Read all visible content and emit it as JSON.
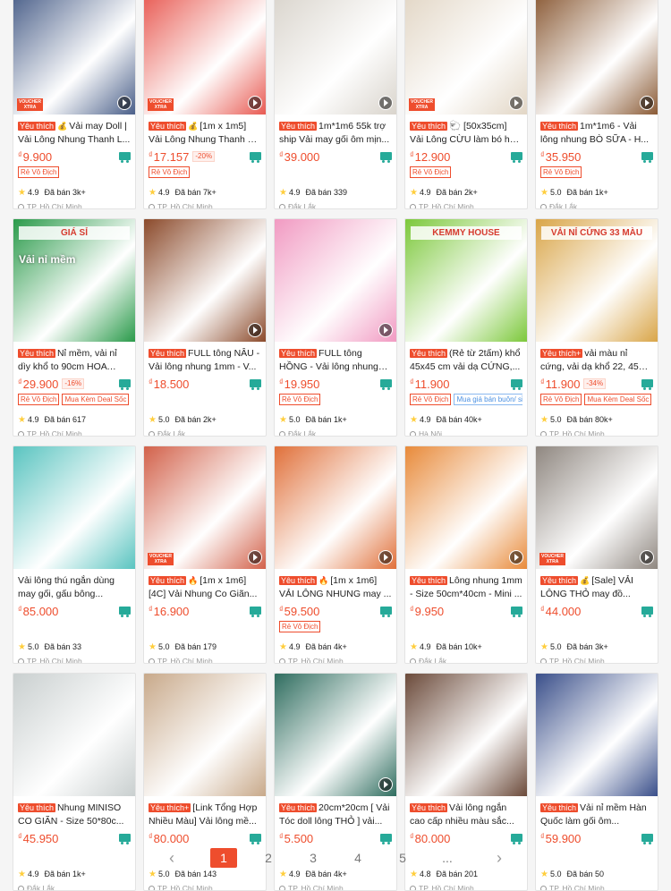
{
  "products": [
    {
      "title": "Vải may Doll | Vải Lông Nhung Thanh L...",
      "tag": "Yêu thích",
      "fire": "💰",
      "price": "9.900",
      "currency": "₫",
      "discount": "",
      "badges": [
        "Rẻ Vô Địch"
      ],
      "rating": "4.9",
      "sold": "Đã bán 3k+",
      "location": "TP. Hồ Chí Minh",
      "thumb": "#4a5f89",
      "video": true,
      "voucher": true
    },
    {
      "title": "[1m x 1m5] Vải Lông Nhung Thanh Lý m...",
      "tag": "Yêu thích",
      "fire": "💰",
      "price": "17.157",
      "currency": "₫",
      "discount": "-20%",
      "badges": [
        "Rẻ Vô Địch"
      ],
      "rating": "4.9",
      "sold": "Đã bán 7k+",
      "location": "TP. Hồ Chí Minh",
      "thumb": "#e85a52",
      "video": true,
      "voucher": true
    },
    {
      "title": "1m*1m6 55k trợ ship Vải may gối ôm mịn...",
      "tag": "Yêu thích",
      "fire": "",
      "price": "39.000",
      "currency": "₫",
      "discount": "",
      "badges": [],
      "rating": "4.9",
      "sold": "Đã bán 339",
      "location": "Đắk Lắk",
      "thumb": "#d9d4cc",
      "video": true,
      "voucher": false
    },
    {
      "title": "🐑 [50x35cm] Vải Lông CỪU làm bó hoa ta...",
      "tag": "Yêu thích",
      "fire": "",
      "price": "12.900",
      "currency": "₫",
      "discount": "",
      "badges": [
        "Rẻ Vô Địch"
      ],
      "rating": "4.9",
      "sold": "Đã bán 2k+",
      "location": "TP. Hồ Chí Minh",
      "thumb": "#e2d6c5",
      "video": true,
      "voucher": true
    },
    {
      "title": "1m*1m6 - Vải lông nhung BÒ SỮA - H...",
      "tag": "Yêu thích",
      "fire": "",
      "price": "35.950",
      "currency": "₫",
      "discount": "",
      "badges": [
        "Rẻ Vô Địch"
      ],
      "rating": "5.0",
      "sold": "Đã bán 1k+",
      "location": "Đắk Lắk",
      "thumb": "#8a5a35",
      "video": true,
      "voucher": false
    },
    {
      "title": "Nỉ mềm, vải nỉ dìy khổ to 90cm HOA GẠ...",
      "tag": "Yêu thích",
      "fire": "",
      "price": "29.900",
      "currency": "₫",
      "discount": "-16%",
      "badges": [
        "Rẻ Vô Địch",
        "Mua Kèm Deal Sốc"
      ],
      "rating": "4.9",
      "sold": "Đã bán 617",
      "location": "TP. Hồ Chí Minh",
      "thumb": "#2a9a4a",
      "video": false,
      "voucher": false,
      "banner": "GIÁ SỈ",
      "overlay": "Vải nỉ mềm"
    },
    {
      "title": "FULL tông NÂU - Vải lông nhung 1mm - V...",
      "tag": "Yêu thích",
      "fire": "",
      "price": "18.500",
      "currency": "₫",
      "discount": "",
      "badges": [],
      "rating": "5.0",
      "sold": "Đã bán 2k+",
      "location": "Đắk Lắk",
      "thumb": "#8b4a2b",
      "video": true,
      "voucher": false
    },
    {
      "title": "FULL tông HỒNG - Vải lông nhung 1mm - ...",
      "tag": "Yêu thích",
      "fire": "",
      "price": "19.950",
      "currency": "₫",
      "discount": "",
      "badges": [
        "Rẻ Vô Địch"
      ],
      "rating": "5.0",
      "sold": "Đã bán 1k+",
      "location": "Đắk Lắk",
      "thumb": "#f19ac2",
      "video": true,
      "voucher": false
    },
    {
      "title": "(Rẻ từ 2tấm) khổ 45x45 cm vải dạ CỨNG,...",
      "tag": "Yêu thích",
      "fire": "",
      "price": "11.900",
      "currency": "₫",
      "discount": "",
      "badges": [
        "Rẻ Vô Địch",
        "Mua giá bán buôn/ sỉ"
      ],
      "rating": "4.9",
      "sold": "Đã bán 40k+",
      "location": "Hà Nội",
      "thumb": "#7cc83b",
      "video": false,
      "voucher": false,
      "banner": "KEMMY HOUSE"
    },
    {
      "title": "vải màu nỉ cứng, vải dạ khổ 22, 45 cm...",
      "tag": "Yêu thích+",
      "fire": "",
      "price": "11.900",
      "currency": "₫",
      "discount": "-34%",
      "badges": [
        "Rẻ Vô Địch",
        "Mua Kèm Deal Sốc"
      ],
      "rating": "5.0",
      "sold": "Đã bán 80k+",
      "location": "TP. Hồ Chí Minh",
      "thumb": "#d9a548",
      "video": false,
      "voucher": false,
      "banner": "VẢI NỈ CỨNG 33 MÀU"
    },
    {
      "title": "Vải lông thú ngắn dùng may gối, gấu bông...",
      "tag": "",
      "fire": "",
      "price": "85.000",
      "currency": "₫",
      "discount": "",
      "badges": [],
      "rating": "5.0",
      "sold": "Đã bán 33",
      "location": "TP. Hồ Chí Minh",
      "thumb": "#5ac4c0",
      "video": false,
      "voucher": false
    },
    {
      "title": "[1m x 1m6] [4C] Vải Nhung Co Giãn...",
      "tag": "Yêu thích",
      "fire": "🔥",
      "price": "16.900",
      "currency": "₫",
      "discount": "",
      "badges": [],
      "rating": "5.0",
      "sold": "Đã bán 179",
      "location": "TP. Hồ Chí Minh",
      "thumb": "#d2614a",
      "video": true,
      "voucher": true
    },
    {
      "title": "[1m x 1m6] VẢI LÔNG NHUNG may ...",
      "tag": "Yêu thích",
      "fire": "🔥",
      "price": "59.500",
      "currency": "₫",
      "discount": "",
      "badges": [
        "Rẻ Vô Địch"
      ],
      "rating": "4.9",
      "sold": "Đã bán 4k+",
      "location": "TP. Hồ Chí Minh",
      "thumb": "#e0703a",
      "video": true,
      "voucher": false
    },
    {
      "title": "Lông nhung 1mm - Size 50cm*40cm - Mini ...",
      "tag": "Yêu thích",
      "fire": "",
      "price": "9.950",
      "currency": "₫",
      "discount": "",
      "badges": [],
      "rating": "4.9",
      "sold": "Đã bán 10k+",
      "location": "Đắk Lắk",
      "thumb": "#e88a3a",
      "video": true,
      "voucher": false
    },
    {
      "title": "[Sale] VẢI LÔNG THỎ may đồ...",
      "tag": "Yêu thích",
      "fire": "💰",
      "price": "44.000",
      "currency": "₫",
      "discount": "",
      "badges": [],
      "rating": "5.0",
      "sold": "Đã bán 3k+",
      "location": "TP. Hồ Chí Minh",
      "thumb": "#8f8780",
      "video": true,
      "voucher": true
    },
    {
      "title": "Nhung MINISO CO GIÃN - Size 50*80c...",
      "tag": "Yêu thích",
      "fire": "",
      "price": "45.950",
      "currency": "₫",
      "discount": "",
      "badges": [],
      "rating": "4.9",
      "sold": "Đã bán 1k+",
      "location": "Đắk Lắk",
      "thumb": "#c9cfcf",
      "video": false,
      "voucher": false
    },
    {
      "title": "[Link Tổng Hợp Nhiều Màu] Vải lông mề...",
      "tag": "Yêu thích+",
      "fire": "",
      "price": "80.000",
      "currency": "₫",
      "discount": "",
      "badges": [],
      "rating": "5.0",
      "sold": "Đã bán 143",
      "location": "TP. Hồ Chí Minh",
      "thumb": "#c8a98a",
      "video": false,
      "voucher": false
    },
    {
      "title": "20cm*20cm [ Vải Tóc doll lông THỎ ] vải...",
      "tag": "Yêu thích",
      "fire": "",
      "price": "5.500",
      "currency": "₫",
      "discount": "",
      "badges": [],
      "rating": "4.9",
      "sold": "Đã bán 4k+",
      "location": "TP. Hồ Chí Minh",
      "thumb": "#2f6d5f",
      "video": true,
      "voucher": false
    },
    {
      "title": "Vải lông ngắn cao cấp nhiều màu sắc...",
      "tag": "Yêu thích",
      "fire": "",
      "price": "80.000",
      "currency": "₫",
      "discount": "",
      "badges": [],
      "rating": "4.8",
      "sold": "Đã bán 201",
      "location": "TP. Hồ Chí Minh",
      "thumb": "#6b4a3a",
      "video": false,
      "voucher": false
    },
    {
      "title": "Vải nỉ mềm Hàn Quốc làm gối ôm...",
      "tag": "Yêu thích",
      "fire": "",
      "price": "59.900",
      "currency": "₫",
      "discount": "",
      "badges": [],
      "rating": "5.0",
      "sold": "Đã bán 50",
      "location": "TP. Hồ Chí Minh",
      "thumb": "#3a4f8a",
      "video": false,
      "voucher": false
    }
  ],
  "pagination": {
    "prev": "‹",
    "next": "›",
    "pages": [
      "1",
      "2",
      "3",
      "4",
      "5",
      "..."
    ],
    "active": "1"
  }
}
